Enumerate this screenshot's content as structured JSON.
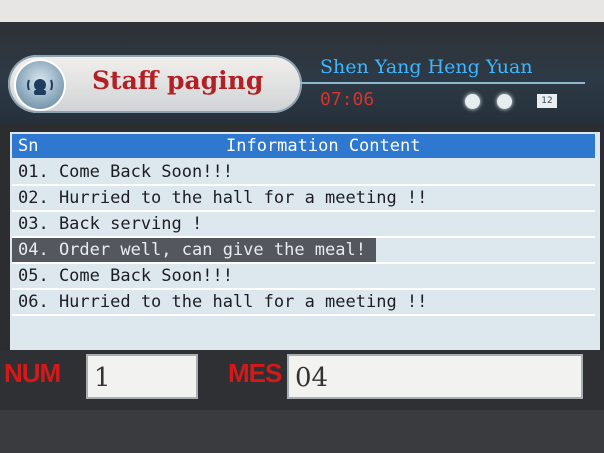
{
  "header": {
    "title": "Staff paging",
    "company": "Shen Yang Heng Yuan",
    "time": "07:06",
    "badge": "12"
  },
  "table": {
    "columns": {
      "sn": "Sn",
      "info": "Information Content"
    },
    "rows": [
      "01. Come Back Soon!!!",
      "02. Hurried to the hall for a meeting !!",
      "03. Back serving !",
      "04. Order well, can give the meal!",
      "05. Come Back Soon!!!",
      "06. Hurried to the hall for a meeting !!"
    ],
    "selected_index": 3
  },
  "footer": {
    "num_label": "NUM",
    "num_value": "1",
    "mes_label": "MES",
    "mes_value": "04"
  },
  "colors": {
    "header_bar": "#2f78d0",
    "title": "#b21f24",
    "company": "#3fb6ff",
    "time": "#d4342d",
    "label_red": "#d51818",
    "selected_row": "#54585e"
  },
  "icons": [
    "pager-logo-icon",
    "status-dot-icon"
  ]
}
